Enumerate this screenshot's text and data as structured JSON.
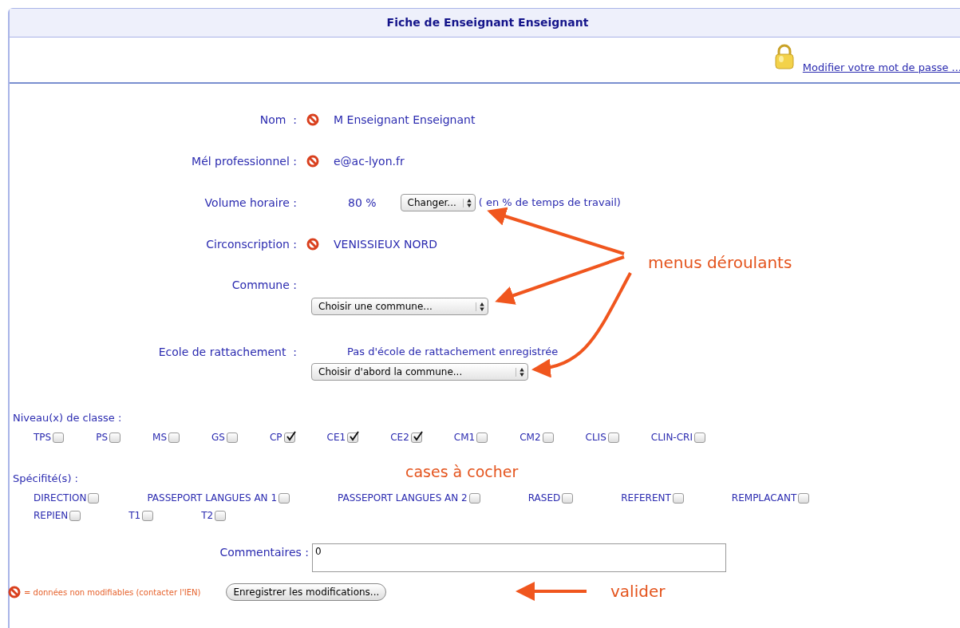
{
  "title": "Fiche de Enseignant Enseignant",
  "password_link": "Modifier votre mot de passe ...",
  "fields": [
    {
      "kind": "locked",
      "label": "Nom  :",
      "value": "M Enseignant Enseignant"
    },
    {
      "kind": "locked",
      "label": "Mél professionnel :",
      "value": "e@ac-lyon.fr"
    },
    {
      "kind": "inline_select",
      "label": "Volume horaire :",
      "value": "80 %",
      "select": "Changer...",
      "note": "( en % de temps de travail)"
    },
    {
      "kind": "locked",
      "label": "Circonscription :",
      "value": "VENISSIEUX NORD"
    },
    {
      "kind": "select_below",
      "label": "Commune :",
      "select": "Choisir une commune..."
    },
    {
      "kind": "value_select",
      "label": "Ecole de rattachement  :",
      "value": "Pas d'école de rattachement enregistrée",
      "select": "Choisir d'abord la commune..."
    }
  ],
  "levels": {
    "label": "Niveau(x) de classe :",
    "items": [
      {
        "label": "TPS",
        "checked": false
      },
      {
        "label": "PS",
        "checked": false
      },
      {
        "label": "MS",
        "checked": false
      },
      {
        "label": "GS",
        "checked": false
      },
      {
        "label": "CP",
        "checked": true
      },
      {
        "label": "CE1",
        "checked": true
      },
      {
        "label": "CE2",
        "checked": true
      },
      {
        "label": "CM1",
        "checked": false
      },
      {
        "label": "CM2",
        "checked": false
      },
      {
        "label": "CLIS",
        "checked": false
      },
      {
        "label": "CLIN-CRI",
        "checked": false
      }
    ]
  },
  "specialties": {
    "label": "Spécifité(s) :",
    "items": [
      {
        "label": "DIRECTION",
        "checked": false
      },
      {
        "label": "PASSEPORT LANGUES AN 1",
        "checked": false
      },
      {
        "label": "PASSEPORT LANGUES AN 2",
        "checked": false
      },
      {
        "label": "RASED",
        "checked": false
      },
      {
        "label": "REFERENT",
        "checked": false
      },
      {
        "label": "REMPLACANT",
        "checked": false
      },
      {
        "label": "REPIEN",
        "checked": false
      },
      {
        "label": "T1",
        "checked": false
      },
      {
        "label": "T2",
        "checked": false
      }
    ]
  },
  "comments": {
    "label": "Commentaires :",
    "value": "0"
  },
  "legend": "= données non modifiables (contacter l'IEN)",
  "save_button": "Enregistrer les modifications...",
  "annotations": {
    "menus": "menus déroulants",
    "checkboxes": "cases à cocher",
    "submit": "valider"
  }
}
